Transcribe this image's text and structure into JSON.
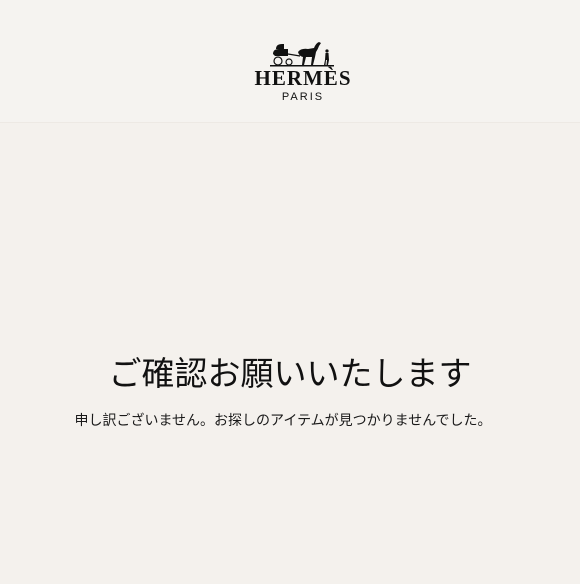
{
  "header": {
    "logo": {
      "icon": "horse-and-carriage-icon",
      "wordmark": "HERMÈS",
      "city": "PARIS"
    }
  },
  "main": {
    "title": "ご確認お願いいたします",
    "message": "申し訳ございません。お探しのアイテムが見つかりませんでした。"
  },
  "colors": {
    "background": "#f4f1ed",
    "header_background": "#f5f3f0",
    "text": "#111111"
  }
}
